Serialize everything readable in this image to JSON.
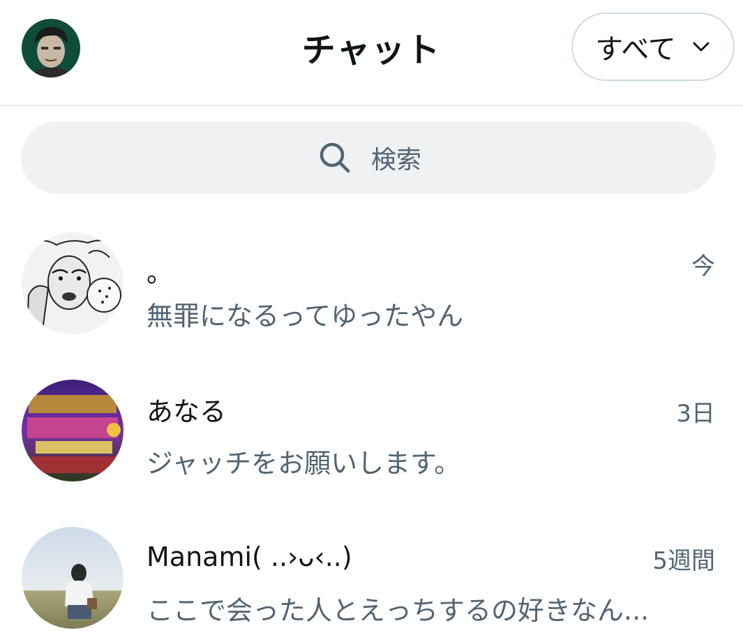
{
  "header": {
    "title": "チャット",
    "filter_label": "すべて",
    "filter_icon": "chevron-down-icon",
    "avatar_icon": "profile-avatar"
  },
  "search": {
    "placeholder": "検索",
    "icon": "search-icon"
  },
  "conversations": [
    {
      "name": "。",
      "time": "今",
      "preview": "無罪になるってゆったやん"
    },
    {
      "name": "あなる",
      "time": "3日",
      "preview": "ジャッチをお願いします。"
    },
    {
      "name": "Manami( ..›ᴗ‹..)",
      "time": "5週間",
      "preview": "ここで会った人とえっちするの好きなん..."
    }
  ],
  "colors": {
    "primary_text": "#0f1419",
    "secondary_text": "#536471",
    "border": "#cfd9de",
    "search_bg": "#eff1f3"
  }
}
